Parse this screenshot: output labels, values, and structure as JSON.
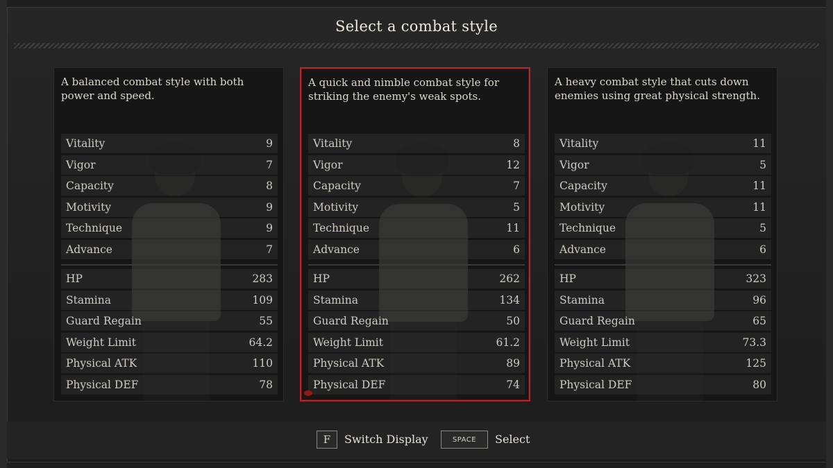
{
  "title": "Select a combat style",
  "accent_color": "#b3262a",
  "panels": [
    {
      "description": "A balanced combat style with both power and speed.",
      "selected": false,
      "attributes": [
        {
          "label": "Vitality",
          "value": "9"
        },
        {
          "label": "Vigor",
          "value": "7"
        },
        {
          "label": "Capacity",
          "value": "8"
        },
        {
          "label": "Motivity",
          "value": "9"
        },
        {
          "label": "Technique",
          "value": "9"
        },
        {
          "label": "Advance",
          "value": "7"
        }
      ],
      "stats": [
        {
          "label": "HP",
          "value": "283"
        },
        {
          "label": "Stamina",
          "value": "109"
        },
        {
          "label": "Guard Regain",
          "value": "55"
        },
        {
          "label": "Weight Limit",
          "value": "64.2"
        },
        {
          "label": "Physical ATK",
          "value": "110"
        },
        {
          "label": "Physical DEF",
          "value": "78"
        }
      ]
    },
    {
      "description": "A quick and nimble combat style for striking the enemy's weak spots.",
      "selected": true,
      "attributes": [
        {
          "label": "Vitality",
          "value": "8"
        },
        {
          "label": "Vigor",
          "value": "12"
        },
        {
          "label": "Capacity",
          "value": "7"
        },
        {
          "label": "Motivity",
          "value": "5"
        },
        {
          "label": "Technique",
          "value": "11"
        },
        {
          "label": "Advance",
          "value": "6"
        }
      ],
      "stats": [
        {
          "label": "HP",
          "value": "262"
        },
        {
          "label": "Stamina",
          "value": "134"
        },
        {
          "label": "Guard Regain",
          "value": "50"
        },
        {
          "label": "Weight Limit",
          "value": "61.2"
        },
        {
          "label": "Physical ATK",
          "value": "89"
        },
        {
          "label": "Physical DEF",
          "value": "74"
        }
      ]
    },
    {
      "description": "A heavy combat style that cuts down enemies using great physical strength.",
      "selected": false,
      "attributes": [
        {
          "label": "Vitality",
          "value": "11"
        },
        {
          "label": "Vigor",
          "value": "5"
        },
        {
          "label": "Capacity",
          "value": "11"
        },
        {
          "label": "Motivity",
          "value": "11"
        },
        {
          "label": "Technique",
          "value": "5"
        },
        {
          "label": "Advance",
          "value": "6"
        }
      ],
      "stats": [
        {
          "label": "HP",
          "value": "323"
        },
        {
          "label": "Stamina",
          "value": "96"
        },
        {
          "label": "Guard Regain",
          "value": "65"
        },
        {
          "label": "Weight Limit",
          "value": "73.3"
        },
        {
          "label": "Physical ATK",
          "value": "125"
        },
        {
          "label": "Physical DEF",
          "value": "80"
        }
      ]
    }
  ],
  "footer": {
    "switch_key": "F",
    "switch_label": "Switch Display",
    "select_key": "SPACE",
    "select_label": "Select"
  }
}
